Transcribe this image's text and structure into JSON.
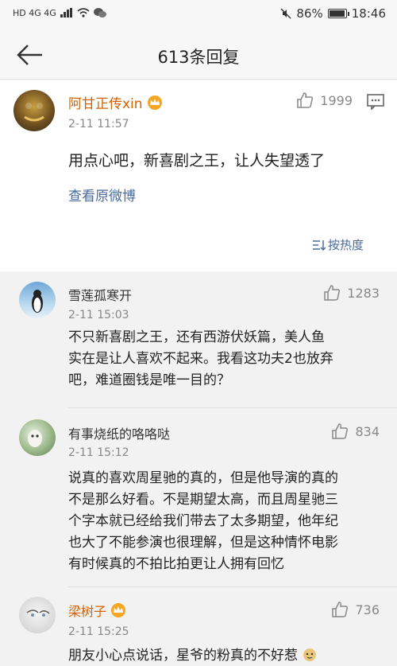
{
  "status_bar": {
    "network": "HD 4G 4G",
    "battery": "86%",
    "battery_level": 0.86,
    "time": "18:46"
  },
  "nav": {
    "title": "613条回复"
  },
  "main_comment": {
    "username": "阿甘正传xin",
    "time": "2-11 11:57",
    "likes": "1999",
    "text": "用点心吧，新喜剧之王，让人失望透了",
    "view_original": "查看原微博",
    "sort_label": "按热度"
  },
  "replies": [
    {
      "username": "雪莲孤寒开",
      "time": "2-11 15:03",
      "likes": "1283",
      "lines": [
        "不只新喜剧之王，还有西游伏妖篇，美人鱼",
        "实在是让人喜欢不起来。我看这功夫2也放弃",
        "吧，难道圈钱是唯一目的？"
      ]
    },
    {
      "username": "有事烧纸的咯咯哒",
      "time": "2-11 15:12",
      "likes": "834",
      "lines": [
        "说真的喜欢周星驰的真的，但是他导演的真的",
        "不是那么好看。不是期望太高，而且周星驰三",
        "个字本就已经给我们带去了太多期望，他年纪",
        "也大了不能参演也很理解，但是这种情怀电影",
        "有时候真的不拍比拍更让人拥有回忆"
      ]
    },
    {
      "username": "梁树子",
      "time": "2-11 15:25",
      "likes": "736",
      "lines": [
        "朋友小心点说话，星爷的粉真的不好惹"
      ]
    }
  ]
}
